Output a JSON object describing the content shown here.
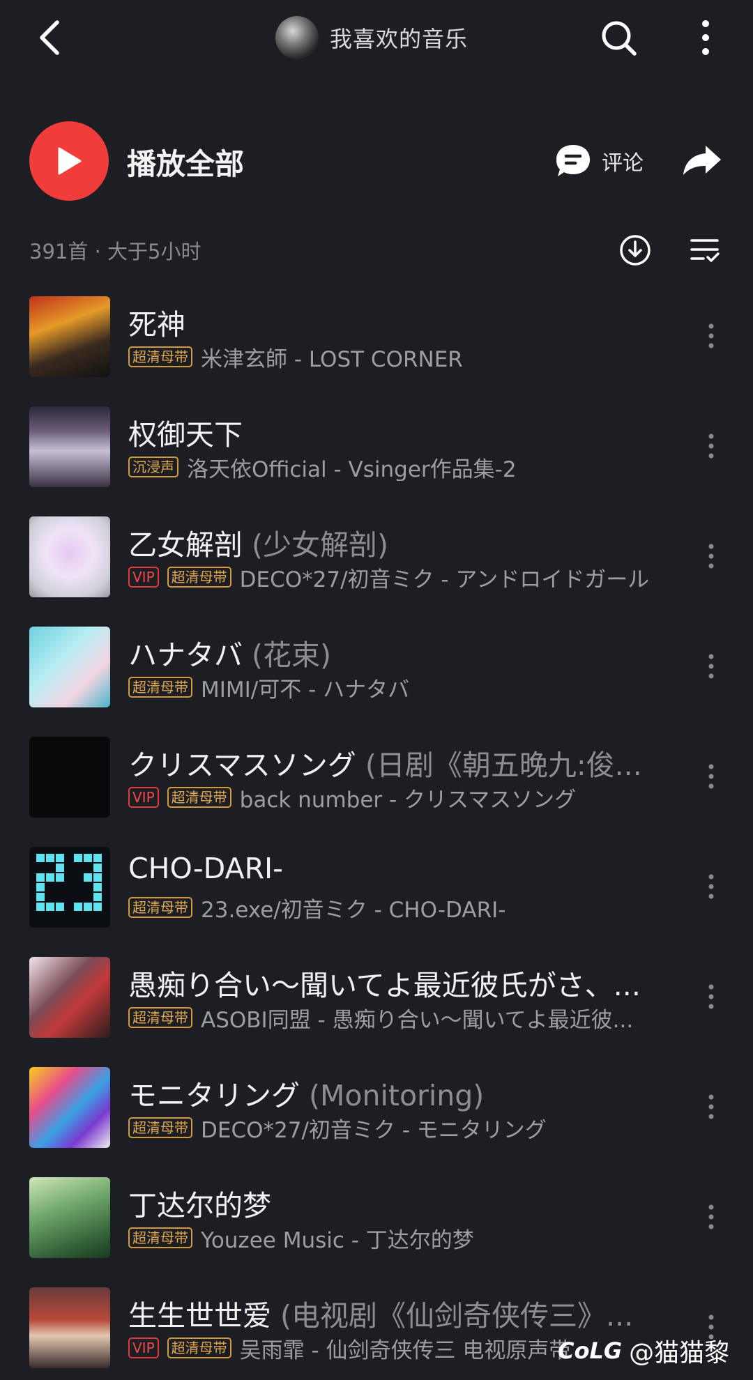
{
  "header": {
    "title": "我喜欢的音乐",
    "back_icon": "back-arrow-icon",
    "search_icon": "search-icon",
    "more_icon": "more-vertical-icon"
  },
  "actions": {
    "play_all_label": "播放全部",
    "comment_label": "评论",
    "share_icon": "share-icon"
  },
  "meta": {
    "count_text": "391首 · 大于5小时",
    "download_icon": "download-icon",
    "sort_icon": "sort-list-icon"
  },
  "songs": [
    {
      "title": "死神",
      "alt": "",
      "badges": [
        "超清母带"
      ],
      "artist": "米津玄師 - LOST CORNER"
    },
    {
      "title": "权御天下",
      "alt": "",
      "badges": [
        "沉浸声"
      ],
      "artist": "洛天依Official - Vsinger作品集-2"
    },
    {
      "title": "乙女解剖",
      "alt": "(少女解剖)",
      "badges": [
        "VIP",
        "超清母带"
      ],
      "artist": "DECO*27/初音ミク - アンドロイドガール"
    },
    {
      "title": "ハナタバ",
      "alt": "(花束)",
      "badges": [
        "超清母带"
      ],
      "artist": "MIMI/可不 - ハナタバ"
    },
    {
      "title": "クリスマスソング",
      "alt": "(日剧《朝五晚九:俊...",
      "badges": [
        "VIP",
        "超清母带"
      ],
      "artist": "back number - クリスマスソング"
    },
    {
      "title": "CHO-DARI-",
      "alt": "",
      "badges": [
        "超清母带"
      ],
      "artist": "23.exe/初音ミク - CHO-DARI-"
    },
    {
      "title": "愚痴り合い～聞いてよ最近彼氏がさ、...",
      "alt": "",
      "badges": [
        "超清母带"
      ],
      "artist": "ASOBI同盟 - 愚痴り合い～聞いてよ最近彼..."
    },
    {
      "title": "モニタリング",
      "alt": "(Monitoring)",
      "badges": [
        "超清母带"
      ],
      "artist": "DECO*27/初音ミク - モニタリング"
    },
    {
      "title": "丁达尔的梦",
      "alt": "",
      "badges": [
        "超清母带"
      ],
      "artist": "Youzee Music - 丁达尔的梦"
    },
    {
      "title": "生生世世爱",
      "alt": "(电视剧《仙剑奇侠传三》...",
      "badges": [
        "VIP",
        "超清母带"
      ],
      "artist": "吴雨霏 - 仙剑奇侠传三 电视原声带"
    }
  ],
  "colors": {
    "background": "#1d1e24",
    "accent_red": "#f13c3c",
    "badge_gold": "#e0a84e",
    "badge_vip": "#f2494b"
  },
  "watermark": {
    "logo": "CoLG",
    "text": "@猫猫黎"
  }
}
